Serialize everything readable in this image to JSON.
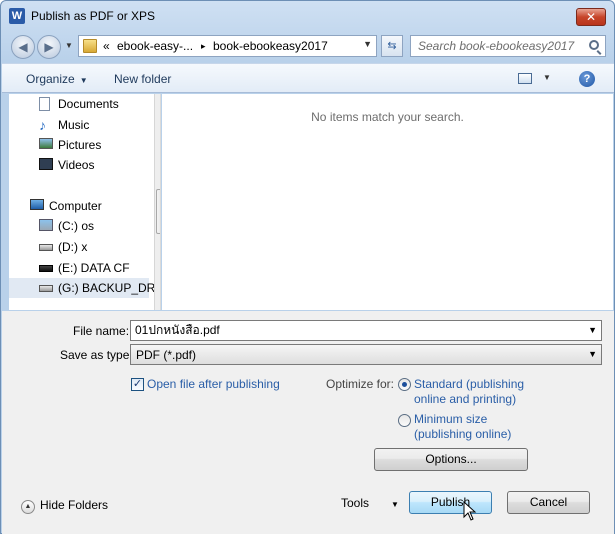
{
  "window": {
    "title": "Publish as PDF or XPS",
    "app_icon": "W"
  },
  "title_buttons": {
    "close": "✕"
  },
  "address_bar": {
    "prefix": "«",
    "crumbs": [
      "ebook-easy-...",
      "book-ebookeasy2017"
    ],
    "separator": "▸"
  },
  "search": {
    "placeholder": "Search book-ebookeasy2017"
  },
  "toolbar": {
    "organize": "Organize",
    "new_folder": "New folder",
    "help": "?"
  },
  "nav_tree": [
    {
      "label": "Documents",
      "icon": "documents-icon"
    },
    {
      "label": "Music",
      "icon": "music-icon"
    },
    {
      "label": "Pictures",
      "icon": "pictures-icon"
    },
    {
      "label": "Videos",
      "icon": "videos-icon"
    },
    {
      "label": "Computer",
      "icon": "computer-icon"
    },
    {
      "label": "(C:) os",
      "icon": "drive-c-icon"
    },
    {
      "label": "(D:) x",
      "icon": "drive-d-icon"
    },
    {
      "label": "(E:) DATA CF",
      "icon": "drive-e-icon"
    },
    {
      "label": "(G:) BACKUP_DRV",
      "icon": "drive-g-icon"
    }
  ],
  "files": {
    "empty_message": "No items match your search."
  },
  "form": {
    "file_name_label": "File name:",
    "file_name_value": "01ปกหนังสือ.pdf",
    "save_type_label": "Save as type:",
    "save_type_value": "PDF (*.pdf)",
    "open_after_label": "Open file after publishing",
    "open_after_checked": true,
    "optimize_label": "Optimize for:",
    "standard_line1": "Standard (publishing",
    "standard_line2": "online and printing)",
    "minimum_line1": "Minimum size",
    "minimum_line2": "(publishing online)",
    "options_button": "Options..."
  },
  "footer": {
    "hide_folders": "Hide Folders",
    "tools": "Tools",
    "publish": "Publish",
    "cancel": "Cancel"
  },
  "colors": {
    "link_blue": "#2a5ea7",
    "frame": "#b9d1ea"
  }
}
